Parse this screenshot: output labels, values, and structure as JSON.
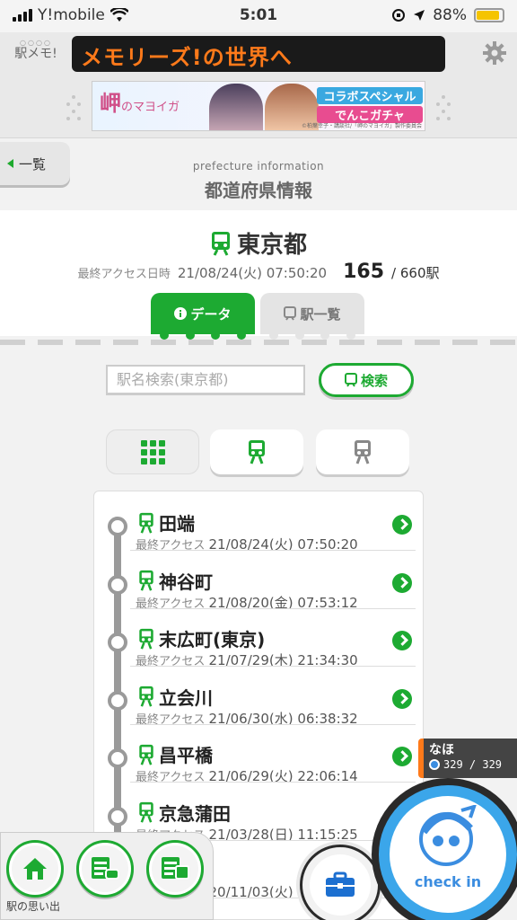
{
  "status_bar": {
    "carrier": "Y!mobile",
    "time": "5:01",
    "battery": "88%",
    "battery_level": 0.88
  },
  "header": {
    "logo_text": "駅メモ!",
    "ticker": "メモリーズ!の世界へ",
    "banner": {
      "title": "岬",
      "title_suffix": "のマヨイガ",
      "collab_line1": "コラボスペシャル",
      "collab_line2": "でんこガチャ",
      "credit": "©柏葉幸子・講談社/「岬のマヨイガ」製作委員会"
    }
  },
  "nav": {
    "back_label": "一覧",
    "section_en": "prefecture information",
    "section_ja": "都道府県情報"
  },
  "prefecture": {
    "name": "東京都",
    "access_label": "最終アクセス日時",
    "access_datetime": "21/08/24(火) 07:50:20",
    "visited": "165",
    "total": "/ 660駅"
  },
  "tabs": {
    "data": "データ",
    "list": "駅一覧"
  },
  "search": {
    "placeholder": "駅名検索(東京都)",
    "button": "検索"
  },
  "stations": [
    {
      "name": "田端",
      "label": "最終アクセス",
      "datetime": "21/08/24(火) 07:50:20"
    },
    {
      "name": "神谷町",
      "label": "最終アクセス",
      "datetime": "21/08/20(金) 07:53:12"
    },
    {
      "name": "末広町(東京)",
      "label": "最終アクセス",
      "datetime": "21/07/29(木) 21:34:30"
    },
    {
      "name": "立会川",
      "label": "最終アクセス",
      "datetime": "21/06/30(水) 06:38:32"
    },
    {
      "name": "昌平橋",
      "label": "最終アクセス",
      "datetime": "21/06/29(火) 22:06:14"
    },
    {
      "name": "京急蒲田",
      "label": "最終アクセス",
      "datetime": "21/03/28(日) 11:15:25"
    },
    {
      "name": "",
      "label": "最終アクセス",
      "datetime": "20/11/03(火)"
    }
  ],
  "bottom_nav": {
    "label": "駅の思い出"
  },
  "user": {
    "name": "なほ",
    "count": "329 / 329"
  },
  "checkin": {
    "label": "check in"
  },
  "colors": {
    "accent_green": "#1daa32",
    "ticker_orange": "#ff7a1a",
    "checkin_blue": "#3ba6ea"
  }
}
